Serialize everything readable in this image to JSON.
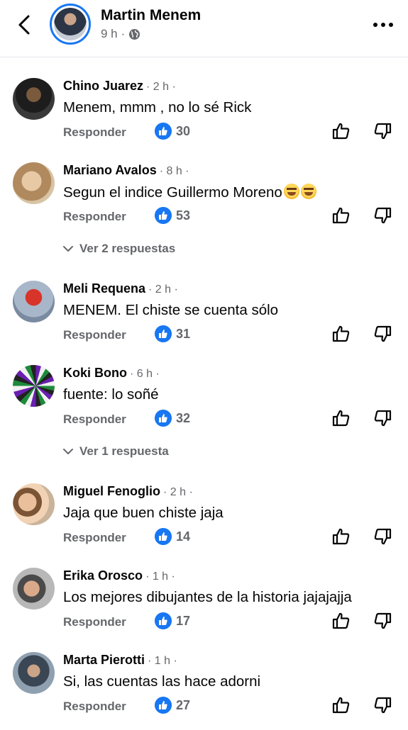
{
  "header": {
    "author": "Martin Menem",
    "time": "9 h",
    "separator": "·",
    "audience_icon": "globe-icon"
  },
  "comments": [
    {
      "name": "Chino Juarez",
      "time": "· 2 h ·",
      "text": "Menem, mmm , no lo sé Rick",
      "reply": "Responder",
      "likes": "30"
    },
    {
      "name": "Mariano Avalos",
      "time": "· 8 h ·",
      "text": "Segun el indice Guillermo Moreno",
      "reply": "Responder",
      "likes": "53",
      "replies_link": "Ver 2 respuestas"
    },
    {
      "name": "Meli Requena",
      "time": "· 2 h ·",
      "text": "MENEM. El chiste se cuenta sólo",
      "reply": "Responder",
      "likes": "31"
    },
    {
      "name": "Koki Bono",
      "time": "· 6 h ·",
      "text": "fuente: lo soñé",
      "reply": "Responder",
      "likes": "32",
      "replies_link": "Ver 1 respuesta"
    },
    {
      "name": "Miguel Fenoglio",
      "time": "· 2 h ·",
      "text": "Jaja que buen chiste jaja",
      "reply": "Responder",
      "likes": "14"
    },
    {
      "name": "Erika Orosco",
      "time": "· 1 h ·",
      "text": "Los mejores dibujantes de la historia jajajajja",
      "reply": "Responder",
      "likes": "17"
    },
    {
      "name": "Marta Pierotti",
      "time": "· 1 h ·",
      "text": "Si, las cuentas las hace adorni",
      "reply": "Responder",
      "likes": "27"
    }
  ],
  "colors": {
    "accent": "#1877f2",
    "secondary_text": "#65676b",
    "primary_text": "#050505"
  }
}
